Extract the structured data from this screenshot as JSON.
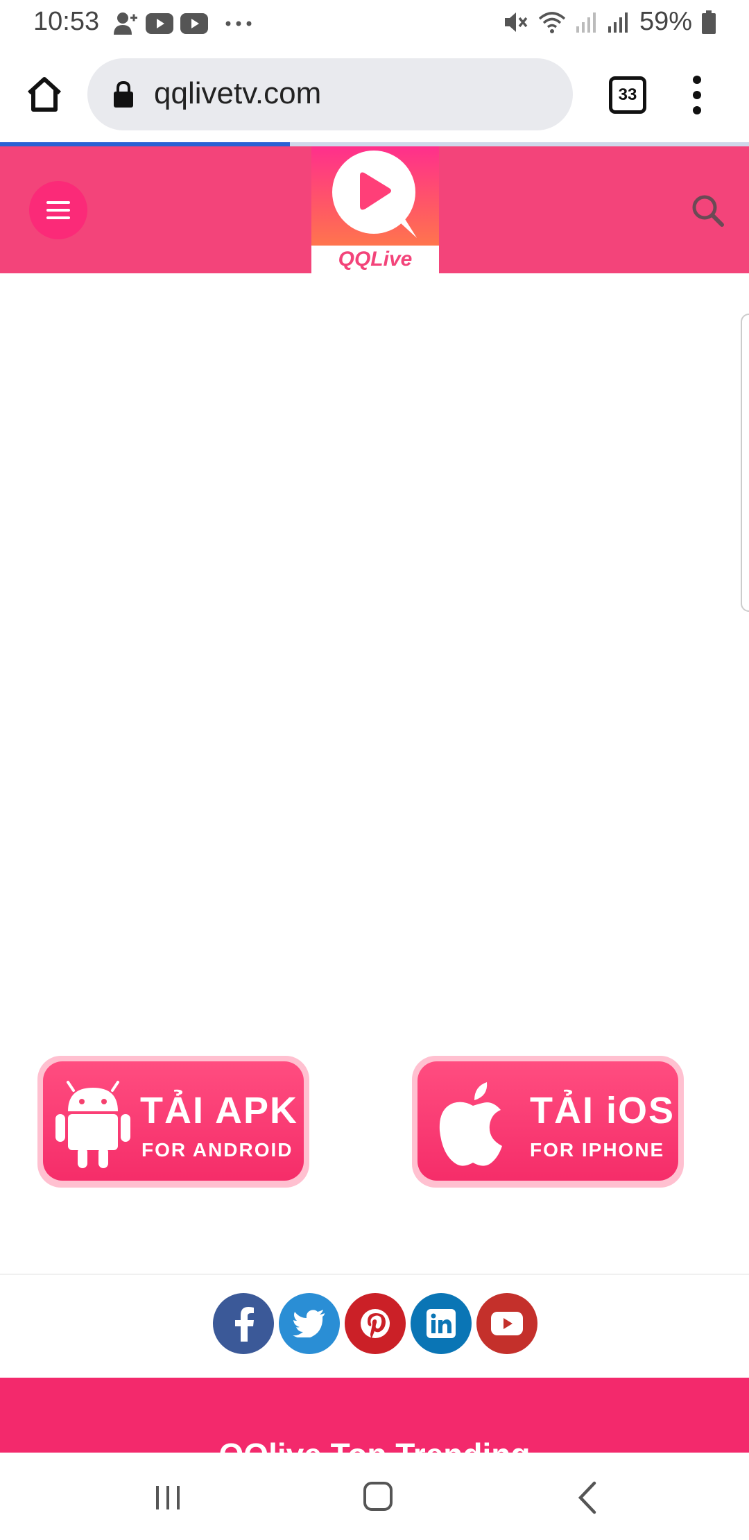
{
  "status_bar": {
    "time": "10:53",
    "battery": "59%"
  },
  "browser": {
    "url": "qqlivetv.com",
    "tab_count": "33",
    "load_progress": 0.387
  },
  "site": {
    "logo_text": "QQLive"
  },
  "downloads": [
    {
      "main": "TẢI APK",
      "sub": "FOR ANDROID",
      "icon": "android-icon"
    },
    {
      "main": "TẢI iOS",
      "sub": "FOR IPHONE",
      "icon": "apple-icon"
    }
  ],
  "social": [
    "facebook-icon",
    "twitter-icon",
    "pinterest-icon",
    "linkedin-icon",
    "youtube-icon"
  ],
  "footer": {
    "title": "QQlive Top Trending"
  },
  "colors": {
    "header": "#f3447a",
    "accent": "#fb2a78",
    "footer": "#f3296c"
  }
}
